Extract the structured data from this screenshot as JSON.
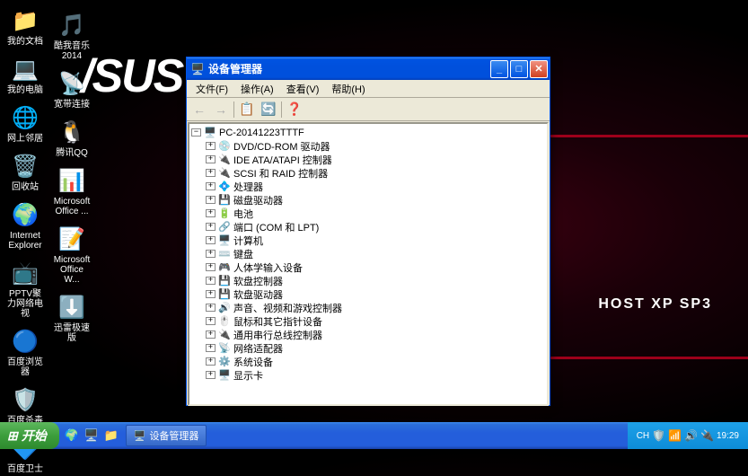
{
  "wallpaper": {
    "brand": "/SUS",
    "text": "HOST XP SP3"
  },
  "desktop_icons_col1": [
    {
      "label": "我的文档",
      "glyph": "📁"
    },
    {
      "label": "我的电脑",
      "glyph": "💻"
    },
    {
      "label": "网上邻居",
      "glyph": "🌐"
    },
    {
      "label": "回收站",
      "glyph": "🗑️"
    },
    {
      "label": "Internet Explorer",
      "glyph": "🌍"
    },
    {
      "label": "PPTV聚力网络电视",
      "glyph": "📺"
    },
    {
      "label": "百度浏览器",
      "glyph": "🔵"
    },
    {
      "label": "百度杀毒",
      "glyph": "🛡️"
    },
    {
      "label": "百度卫士",
      "glyph": "🔷"
    }
  ],
  "desktop_icons_col2": [
    {
      "label": "酷我音乐2014",
      "glyph": "🎵"
    },
    {
      "label": "宽带连接",
      "glyph": "📡"
    },
    {
      "label": "腾讯QQ",
      "glyph": "🐧"
    },
    {
      "label": "Microsoft Office ...",
      "glyph": "📊"
    },
    {
      "label": "Microsoft Office W...",
      "glyph": "📝"
    },
    {
      "label": "迅雷极速版",
      "glyph": "⬇️"
    }
  ],
  "window": {
    "title": "设备管理器",
    "menu": [
      "文件(F)",
      "操作(A)",
      "查看(V)",
      "帮助(H)"
    ],
    "tree_root": "PC-20141223TTTF",
    "tree_items": [
      {
        "icon": "💿",
        "label": "DVD/CD-ROM 驱动器"
      },
      {
        "icon": "🔌",
        "label": "IDE ATA/ATAPI 控制器"
      },
      {
        "icon": "🔌",
        "label": "SCSI 和 RAID 控制器"
      },
      {
        "icon": "💠",
        "label": "处理器"
      },
      {
        "icon": "💾",
        "label": "磁盘驱动器"
      },
      {
        "icon": "🔋",
        "label": "电池"
      },
      {
        "icon": "🔗",
        "label": "端口 (COM 和 LPT)"
      },
      {
        "icon": "🖥️",
        "label": "计算机"
      },
      {
        "icon": "⌨️",
        "label": "键盘"
      },
      {
        "icon": "🎮",
        "label": "人体学输入设备"
      },
      {
        "icon": "💾",
        "label": "软盘控制器"
      },
      {
        "icon": "💾",
        "label": "软盘驱动器"
      },
      {
        "icon": "🔊",
        "label": "声音、视频和游戏控制器"
      },
      {
        "icon": "🖱️",
        "label": "鼠标和其它指针设备"
      },
      {
        "icon": "🔌",
        "label": "通用串行总线控制器"
      },
      {
        "icon": "📡",
        "label": "网络适配器"
      },
      {
        "icon": "⚙️",
        "label": "系统设备"
      },
      {
        "icon": "🖥️",
        "label": "显示卡"
      }
    ]
  },
  "taskbar": {
    "start": "开始",
    "task_item": "设备管理器",
    "tray_lang": "CH",
    "tray_time": "19:29"
  }
}
